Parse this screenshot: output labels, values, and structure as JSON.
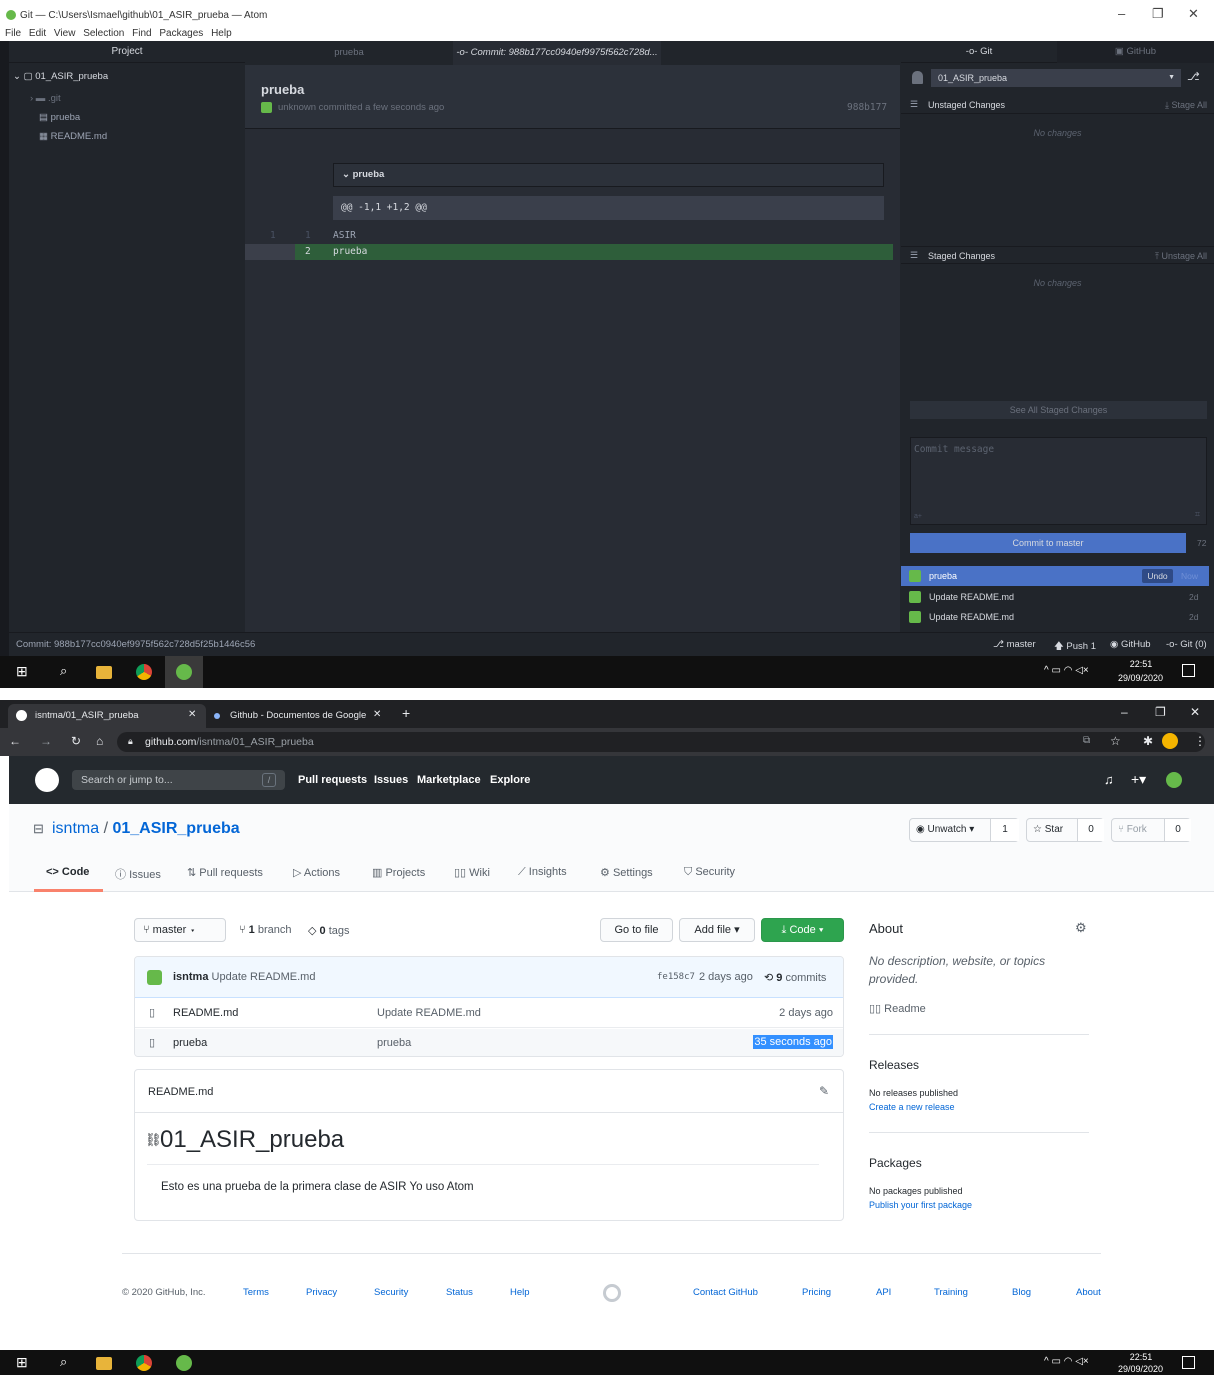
{
  "atom": {
    "window_title": "Git — C:\\Users\\Ismael\\github\\01_ASIR_prueba — Atom",
    "menu": [
      "File",
      "Edit",
      "View",
      "Selection",
      "Find",
      "Packages",
      "Help"
    ],
    "tree": {
      "header": "Project",
      "root": "01_ASIR_prueba",
      "items": [
        ".git",
        "prueba",
        "README.md"
      ]
    },
    "tabs": [
      {
        "label": "prueba"
      },
      {
        "label": "Commit: 988b177cc0940ef9975f562c728d..."
      }
    ],
    "commit": {
      "title": "prueba",
      "author_line": "unknown committed a few seconds ago",
      "sha": "988b177",
      "file_header": "prueba",
      "hunk": "@@ -1,1 +1,2 @@",
      "lines": [
        {
          "old": "1",
          "new": "1",
          "text": "ASIR",
          "added": false
        },
        {
          "old": "",
          "new": "2",
          "text": "prueba",
          "added": true
        }
      ]
    },
    "git_panel": {
      "tab_git": "Git",
      "tab_github": "GitHub",
      "repo": "01_ASIR_prueba",
      "unstaged_title": "Unstaged Changes",
      "stage_all": "Stage All",
      "no_changes": "No changes",
      "staged_title": "Staged Changes",
      "unstage_all": "Unstage All",
      "see_all_staged": "See All Staged Changes",
      "commit_placeholder": "Commit message",
      "commit_button": "Commit to master",
      "char_count": "72",
      "commits": [
        {
          "msg": "prueba",
          "age": "Now",
          "undo": "Undo"
        },
        {
          "msg": "Update README.md",
          "age": "2d"
        },
        {
          "msg": "Update README.md",
          "age": "2d"
        }
      ]
    },
    "status": {
      "left": "Commit: 988b177cc0940ef9975f562c728d5f25b1446c56",
      "branch": "master",
      "push": "Push 1",
      "github": "GitHub",
      "git": "Git (0)"
    }
  },
  "taskbar": {
    "time": "22:51",
    "date": "29/09/2020"
  },
  "chrome": {
    "tabs": [
      {
        "label": "isntma/01_ASIR_prueba"
      },
      {
        "label": "Github - Documentos de Google"
      }
    ],
    "url_domain": "github.com",
    "url_path": "/isntma/01_ASIR_prueba"
  },
  "github": {
    "search_placeholder": "Search or jump to...",
    "search_key": "/",
    "nav": [
      "Pull requests",
      "Issues",
      "Marketplace",
      "Explore"
    ],
    "owner": "isntma",
    "sep": "/",
    "repo": "01_ASIR_prueba",
    "unwatch": "Unwatch",
    "watch_count": "1",
    "star": "Star",
    "star_count": "0",
    "fork": "Fork",
    "fork_count": "0",
    "tabs": [
      "Code",
      "Issues",
      "Pull requests",
      "Actions",
      "Projects",
      "Wiki",
      "Insights",
      "Settings",
      "Security"
    ],
    "branch_btn": "master",
    "branch_count": "1",
    "branch_label": "branch",
    "tag_count": "0",
    "tag_label": "tags",
    "go_to_file": "Go to file",
    "add_file": "Add file",
    "code_btn": "Code",
    "last_commit": {
      "author": "isntma",
      "msg": "Update README.md",
      "sha": "fe158c7",
      "age": "2 days ago",
      "count": "9",
      "count_label": "commits"
    },
    "files": [
      {
        "name": "README.md",
        "msg": "Update README.md",
        "age": "2 days ago"
      },
      {
        "name": "prueba",
        "msg": "prueba",
        "age": "35 seconds ago"
      }
    ],
    "readme_title": "README.md",
    "readme_h1": "01_ASIR_prueba",
    "readme_body": "Esto es una prueba de la primera clase de ASIR Yo uso Atom",
    "about_title": "About",
    "about_desc": "No description, website, or topics provided.",
    "readme_link": "Readme",
    "releases_title": "Releases",
    "releases_none": "No releases published",
    "releases_link": "Create a new release",
    "packages_title": "Packages",
    "packages_none": "No packages published",
    "packages_link": "Publish your first package",
    "footer": {
      "copyright": "© 2020 GitHub, Inc.",
      "left": [
        "Terms",
        "Privacy",
        "Security",
        "Status",
        "Help"
      ],
      "right": [
        "Contact GitHub",
        "Pricing",
        "API",
        "Training",
        "Blog",
        "About"
      ]
    }
  }
}
